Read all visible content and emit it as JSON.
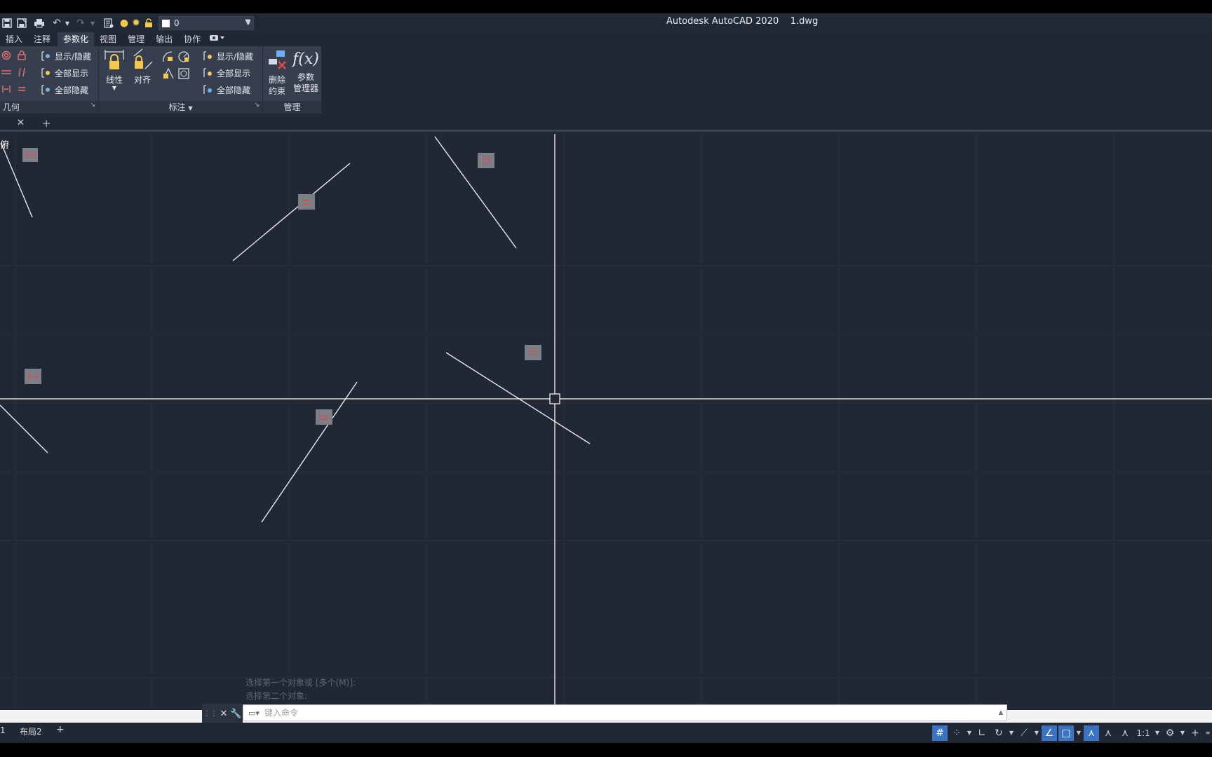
{
  "window": {
    "app_title": "Autodesk AutoCAD 2020    1.dwg"
  },
  "quick_access": {
    "layer_value": "0",
    "icons": [
      "save-icon",
      "save-as-icon",
      "plot-icon",
      "undo-icon",
      "redo-icon",
      "layer-properties-icon",
      "lightbulb-icon",
      "sun-icon",
      "lock-icon"
    ]
  },
  "ribbon_tabs": [
    "插入",
    "注释",
    "参数化",
    "视图",
    "管理",
    "输出",
    "协作"
  ],
  "ribbon_active_tab": "参数化",
  "ribbon": {
    "geometric": {
      "title": "几何",
      "show_hide": "显示/隐藏",
      "show_all": "全部显示",
      "hide_all": "全部隐藏"
    },
    "dimensional": {
      "title": "标注",
      "linear": "线性",
      "aligned": "对齐",
      "show_hide": "显示/隐藏",
      "show_all": "全部显示",
      "hide_all": "全部隐藏"
    },
    "manage": {
      "title": "管理",
      "delete_constraints_1": "删除",
      "delete_constraints_2": "约束",
      "param_manager_1": "参数",
      "param_manager_2": "管理器"
    }
  },
  "viewport_label": "[-][俯视][二维线框]",
  "viewport_label_visible": "俯",
  "constraint_badges": {
    "equal_symbol": "=",
    "parallel_symbol": "//",
    "equal_color": "#e24a4a",
    "badge_bg": "#7a7f88"
  },
  "command_line": {
    "placeholder": "键入命令",
    "history": [
      "选择第一个对象或 [多个(M)]:",
      "选择第二个对象:"
    ]
  },
  "layout_tabs": {
    "model_fragment": "1",
    "layout2": "布局2"
  },
  "status_bar": {
    "scale": "1:1"
  },
  "colors": {
    "background": "#212733",
    "ribbon": "#373f4f",
    "active_tab": "#343d4e",
    "status_active": "#3a72c4"
  }
}
